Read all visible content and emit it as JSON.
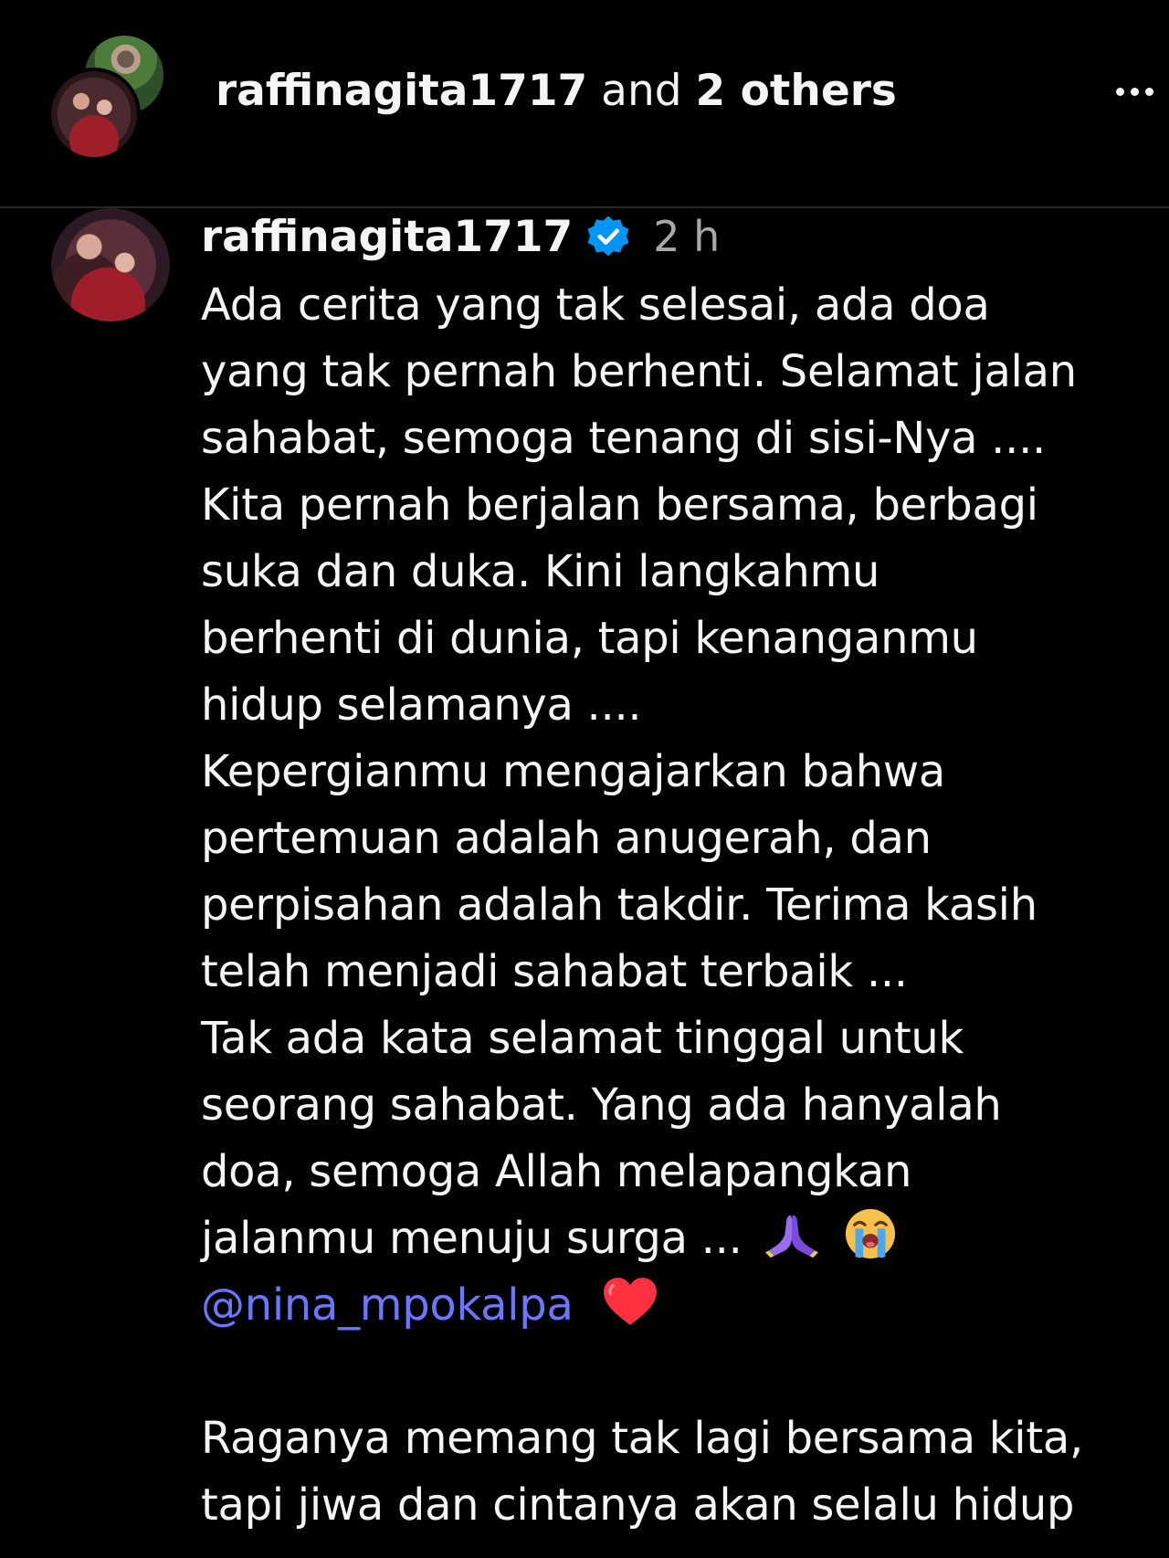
{
  "header": {
    "title_user": "raffinagita1717",
    "title_and": " and ",
    "title_others": "2 others",
    "avatars": [
      "avatar-back",
      "avatar-front"
    ],
    "more_icon": "more-horizontal-icon"
  },
  "comment": {
    "username": "raffinagita1717",
    "verified_icon": "verified-badge-icon",
    "time": "2 h",
    "lines": [
      "Ada cerita yang tak selesai, ada doa",
      "yang tak pernah berhenti. Selamat jalan",
      "sahabat, semoga tenang di sisi-Nya ....",
      "Kita pernah berjalan bersama, berbagi",
      "suka dan duka. Kini langkahmu",
      "berhenti di dunia, tapi kenanganmu",
      "hidup selamanya ....",
      "Kepergianmu mengajarkan bahwa",
      "pertemuan adalah anugerah, dan",
      "perpisahan adalah takdir. Terima kasih",
      "telah menjadi sahabat terbaik ...",
      "Tak ada kata selamat tinggal untuk",
      "seorang sahabat. Yang ada hanyalah",
      "doa, semoga Allah melapangkan"
    ],
    "last_line_text": "jalanmu menuju surga ...",
    "emoji_1": "folded-hands-icon",
    "emoji_2": "loudly-crying-face-icon",
    "mention": "@nina_mpokalpa",
    "heart": "red-heart-icon",
    "second_paragraph": [
      "Raganya memang tak lagi bersama kita,",
      "tapi jiwa dan cintanya akan selalu hidup"
    ]
  },
  "colors": {
    "background": "#000000",
    "text": "#f5f5f5",
    "muted": "#a8a8a8",
    "mention": "#6b76ff",
    "verified": "#0095f6",
    "heart": "#ff3040"
  }
}
